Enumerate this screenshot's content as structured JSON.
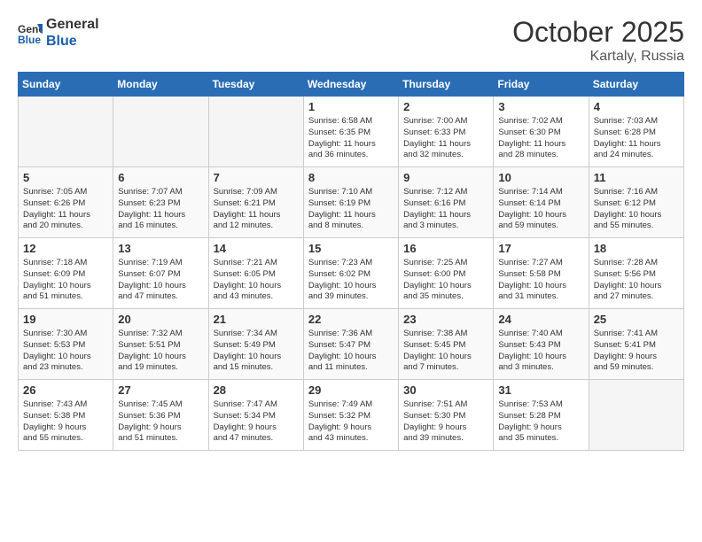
{
  "header": {
    "logo_line1": "General",
    "logo_line2": "Blue",
    "month": "October 2025",
    "location": "Kartaly, Russia"
  },
  "weekdays": [
    "Sunday",
    "Monday",
    "Tuesday",
    "Wednesday",
    "Thursday",
    "Friday",
    "Saturday"
  ],
  "weeks": [
    [
      {
        "day": "",
        "info": ""
      },
      {
        "day": "",
        "info": ""
      },
      {
        "day": "",
        "info": ""
      },
      {
        "day": "1",
        "info": "Sunrise: 6:58 AM\nSunset: 6:35 PM\nDaylight: 11 hours\nand 36 minutes."
      },
      {
        "day": "2",
        "info": "Sunrise: 7:00 AM\nSunset: 6:33 PM\nDaylight: 11 hours\nand 32 minutes."
      },
      {
        "day": "3",
        "info": "Sunrise: 7:02 AM\nSunset: 6:30 PM\nDaylight: 11 hours\nand 28 minutes."
      },
      {
        "day": "4",
        "info": "Sunrise: 7:03 AM\nSunset: 6:28 PM\nDaylight: 11 hours\nand 24 minutes."
      }
    ],
    [
      {
        "day": "5",
        "info": "Sunrise: 7:05 AM\nSunset: 6:26 PM\nDaylight: 11 hours\nand 20 minutes."
      },
      {
        "day": "6",
        "info": "Sunrise: 7:07 AM\nSunset: 6:23 PM\nDaylight: 11 hours\nand 16 minutes."
      },
      {
        "day": "7",
        "info": "Sunrise: 7:09 AM\nSunset: 6:21 PM\nDaylight: 11 hours\nand 12 minutes."
      },
      {
        "day": "8",
        "info": "Sunrise: 7:10 AM\nSunset: 6:19 PM\nDaylight: 11 hours\nand 8 minutes."
      },
      {
        "day": "9",
        "info": "Sunrise: 7:12 AM\nSunset: 6:16 PM\nDaylight: 11 hours\nand 3 minutes."
      },
      {
        "day": "10",
        "info": "Sunrise: 7:14 AM\nSunset: 6:14 PM\nDaylight: 10 hours\nand 59 minutes."
      },
      {
        "day": "11",
        "info": "Sunrise: 7:16 AM\nSunset: 6:12 PM\nDaylight: 10 hours\nand 55 minutes."
      }
    ],
    [
      {
        "day": "12",
        "info": "Sunrise: 7:18 AM\nSunset: 6:09 PM\nDaylight: 10 hours\nand 51 minutes."
      },
      {
        "day": "13",
        "info": "Sunrise: 7:19 AM\nSunset: 6:07 PM\nDaylight: 10 hours\nand 47 minutes."
      },
      {
        "day": "14",
        "info": "Sunrise: 7:21 AM\nSunset: 6:05 PM\nDaylight: 10 hours\nand 43 minutes."
      },
      {
        "day": "15",
        "info": "Sunrise: 7:23 AM\nSunset: 6:02 PM\nDaylight: 10 hours\nand 39 minutes."
      },
      {
        "day": "16",
        "info": "Sunrise: 7:25 AM\nSunset: 6:00 PM\nDaylight: 10 hours\nand 35 minutes."
      },
      {
        "day": "17",
        "info": "Sunrise: 7:27 AM\nSunset: 5:58 PM\nDaylight: 10 hours\nand 31 minutes."
      },
      {
        "day": "18",
        "info": "Sunrise: 7:28 AM\nSunset: 5:56 PM\nDaylight: 10 hours\nand 27 minutes."
      }
    ],
    [
      {
        "day": "19",
        "info": "Sunrise: 7:30 AM\nSunset: 5:53 PM\nDaylight: 10 hours\nand 23 minutes."
      },
      {
        "day": "20",
        "info": "Sunrise: 7:32 AM\nSunset: 5:51 PM\nDaylight: 10 hours\nand 19 minutes."
      },
      {
        "day": "21",
        "info": "Sunrise: 7:34 AM\nSunset: 5:49 PM\nDaylight: 10 hours\nand 15 minutes."
      },
      {
        "day": "22",
        "info": "Sunrise: 7:36 AM\nSunset: 5:47 PM\nDaylight: 10 hours\nand 11 minutes."
      },
      {
        "day": "23",
        "info": "Sunrise: 7:38 AM\nSunset: 5:45 PM\nDaylight: 10 hours\nand 7 minutes."
      },
      {
        "day": "24",
        "info": "Sunrise: 7:40 AM\nSunset: 5:43 PM\nDaylight: 10 hours\nand 3 minutes."
      },
      {
        "day": "25",
        "info": "Sunrise: 7:41 AM\nSunset: 5:41 PM\nDaylight: 9 hours\nand 59 minutes."
      }
    ],
    [
      {
        "day": "26",
        "info": "Sunrise: 7:43 AM\nSunset: 5:38 PM\nDaylight: 9 hours\nand 55 minutes."
      },
      {
        "day": "27",
        "info": "Sunrise: 7:45 AM\nSunset: 5:36 PM\nDaylight: 9 hours\nand 51 minutes."
      },
      {
        "day": "28",
        "info": "Sunrise: 7:47 AM\nSunset: 5:34 PM\nDaylight: 9 hours\nand 47 minutes."
      },
      {
        "day": "29",
        "info": "Sunrise: 7:49 AM\nSunset: 5:32 PM\nDaylight: 9 hours\nand 43 minutes."
      },
      {
        "day": "30",
        "info": "Sunrise: 7:51 AM\nSunset: 5:30 PM\nDaylight: 9 hours\nand 39 minutes."
      },
      {
        "day": "31",
        "info": "Sunrise: 7:53 AM\nSunset: 5:28 PM\nDaylight: 9 hours\nand 35 minutes."
      },
      {
        "day": "",
        "info": ""
      }
    ]
  ]
}
